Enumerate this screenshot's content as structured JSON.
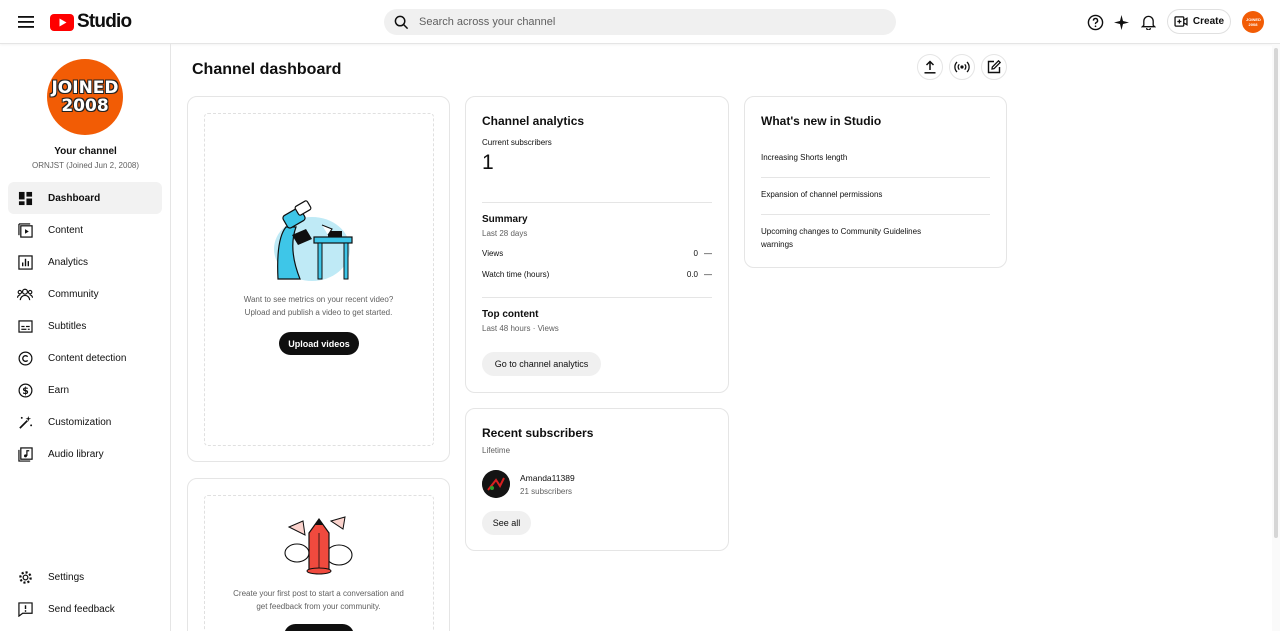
{
  "header": {
    "logo_text": "Studio",
    "search_placeholder": "Search across your channel",
    "create_label": "Create",
    "avatar_text": "JOINED 2008"
  },
  "channel": {
    "avatar_line1": "JOINED",
    "avatar_line2": "2008",
    "title": "Your channel",
    "subtitle": "ORNJST (Joined Jun 2, 2008)"
  },
  "sidebar": {
    "items": [
      {
        "label": "Dashboard",
        "icon": "dashboard-icon"
      },
      {
        "label": "Content",
        "icon": "content-icon"
      },
      {
        "label": "Analytics",
        "icon": "analytics-icon"
      },
      {
        "label": "Community",
        "icon": "community-icon"
      },
      {
        "label": "Subtitles",
        "icon": "subtitles-icon"
      },
      {
        "label": "Content detection",
        "icon": "copyright-icon"
      },
      {
        "label": "Earn",
        "icon": "dollar-icon"
      },
      {
        "label": "Customization",
        "icon": "magic-wand-icon"
      },
      {
        "label": "Audio library",
        "icon": "audio-library-icon"
      }
    ],
    "bottom": [
      {
        "label": "Settings",
        "icon": "gear-icon"
      },
      {
        "label": "Send feedback",
        "icon": "feedback-icon"
      }
    ]
  },
  "main": {
    "title": "Channel dashboard",
    "upload_card": {
      "text_line1": "Want to see metrics on your recent video?",
      "text_line2": "Upload and publish a video to get started.",
      "button": "Upload videos"
    },
    "post_card": {
      "text_line1": "Create your first post to start a conversation and",
      "text_line2": "get feedback from your community."
    },
    "analytics": {
      "title": "Channel analytics",
      "subscribers_label": "Current subscribers",
      "subscribers_value": "1",
      "summary_title": "Summary",
      "summary_period": "Last 28 days",
      "views_label": "Views",
      "views_value": "0",
      "views_change": "—",
      "watch_label": "Watch time (hours)",
      "watch_value": "0.0",
      "watch_change": "—",
      "top_title": "Top content",
      "top_period": "Last 48 hours · Views",
      "button": "Go to channel analytics"
    },
    "recent_subs": {
      "title": "Recent subscribers",
      "period": "Lifetime",
      "sub_name": "Amanda11389",
      "sub_count": "21 subscribers",
      "button": "See all"
    },
    "whats_new": {
      "title": "What's new in Studio",
      "items": [
        "Increasing Shorts length",
        "Expansion of channel permissions",
        "Upcoming changes to Community Guidelines warnings"
      ]
    }
  },
  "colors": {
    "brand_red": "#ff0000",
    "avatar_orange": "#f25c05",
    "illustration_cyan": "#3ec6e8",
    "illustration_red": "#f04a3e"
  }
}
